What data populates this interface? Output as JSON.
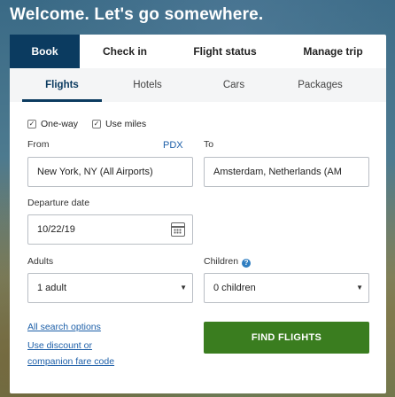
{
  "hero": {
    "title": "Welcome. Let's go somewhere."
  },
  "main_tabs": [
    {
      "label": "Book",
      "active": true
    },
    {
      "label": "Check in"
    },
    {
      "label": "Flight status"
    },
    {
      "label": "Manage trip"
    }
  ],
  "sub_tabs": [
    {
      "label": "Flights",
      "active": true
    },
    {
      "label": "Hotels"
    },
    {
      "label": "Cars"
    },
    {
      "label": "Packages"
    }
  ],
  "options": {
    "one_way": {
      "label": "One-way",
      "checked": true
    },
    "use_miles": {
      "label": "Use miles",
      "checked": true
    }
  },
  "from": {
    "label": "From",
    "code_link": "PDX",
    "value": "New York, NY (All Airports)"
  },
  "to": {
    "label": "To",
    "value": "Amsterdam, Netherlands (AM"
  },
  "departure": {
    "label": "Departure date",
    "value": "10/22/19"
  },
  "adults": {
    "label": "Adults",
    "value": "1 adult"
  },
  "children": {
    "label": "Children",
    "value": "0 children"
  },
  "links": {
    "all_search_options": "All search options",
    "use_discount_line1": "Use discount or",
    "use_discount_line2": "companion fare code"
  },
  "find_button": "FIND FLIGHTS",
  "colors": {
    "primary": "#0b3b60",
    "cta": "#3a7d1f",
    "link": "#1d5fa8"
  }
}
